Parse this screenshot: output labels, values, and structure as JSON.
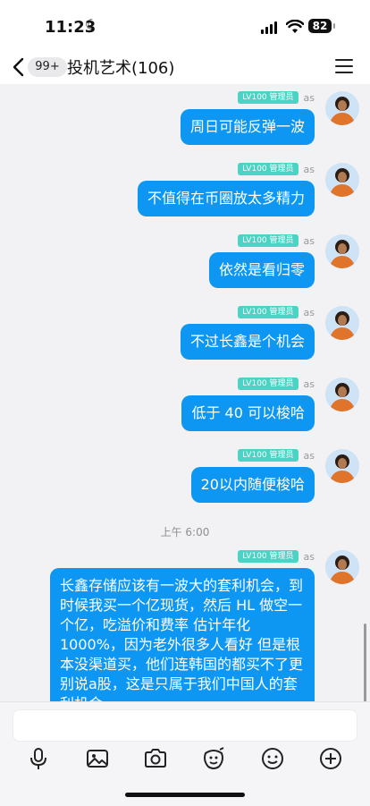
{
  "status_bar": {
    "time": "11:23",
    "battery": "82"
  },
  "header": {
    "unread_badge": "99+",
    "title": "投机艺术(106)"
  },
  "sender": {
    "level_tag": "LV100 管理员",
    "name": "as"
  },
  "messages": [
    {
      "text": "周日可能反弹一波"
    },
    {
      "text": "不值得在币圈放太多精力"
    },
    {
      "text": "依然是看归零"
    },
    {
      "text": "不过长鑫是个机会"
    },
    {
      "text": "低于 40 可以梭哈"
    },
    {
      "text": "20以内随便梭哈"
    },
    {
      "text": "长鑫存储应该有一波大的套利机会，到时候我买一个亿现货，然后 HL 做空一个亿，吃溢价和费率 估计年化 1000%，因为老外很多人看好 但是根本没渠道买，他们连韩国的都买不了更别说a股，这是只属于我们中国人的套利机会"
    }
  ],
  "timestamp": "上午 6:00",
  "toolbar": {
    "icons": [
      "microphone-icon",
      "image-icon",
      "camera-icon",
      "sticker-icon",
      "emoji-icon",
      "plus-icon"
    ]
  },
  "colors": {
    "bubble": "#0d97f2",
    "level_tag": "#4bd3c5",
    "background": "#f2f2f4"
  }
}
